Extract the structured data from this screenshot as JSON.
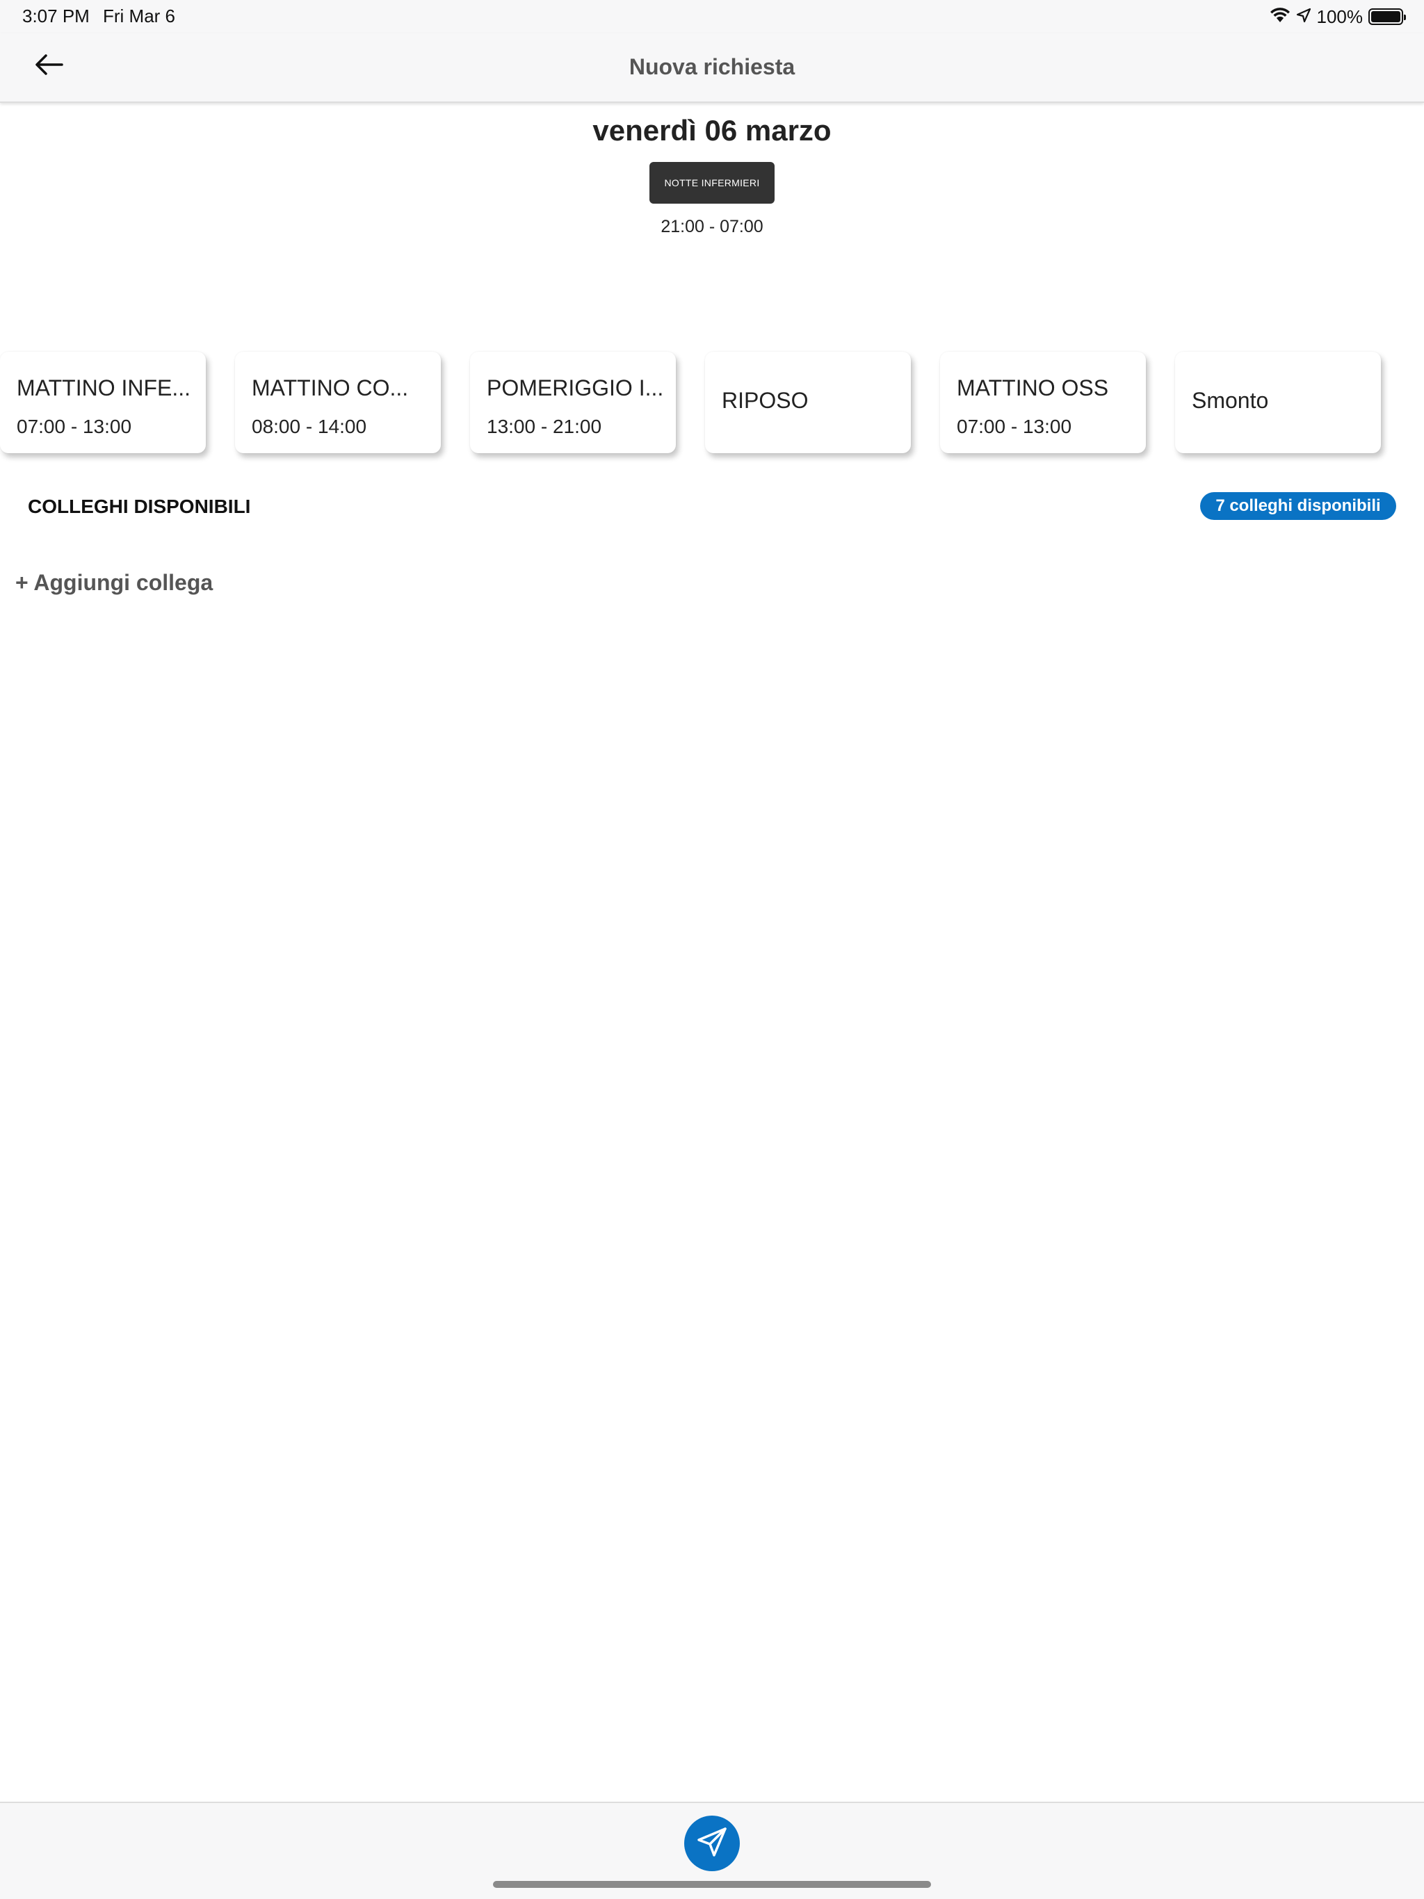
{
  "status_bar": {
    "time": "3:07 PM",
    "date": "Fri Mar 6",
    "battery": "100%",
    "icons": [
      "wifi-icon",
      "location-icon",
      "battery-icon"
    ]
  },
  "header": {
    "title": "Nuova richiesta",
    "back_icon": "arrow-left-icon"
  },
  "shift": {
    "date": "venerdì 06 marzo",
    "name": "NOTTE INFERMIERI",
    "time": "21:00 - 07:00"
  },
  "cards": [
    {
      "name": "MATTINO INFE...",
      "time": "07:00 - 13:00"
    },
    {
      "name": "MATTINO CO...",
      "time": "08:00 - 14:00"
    },
    {
      "name": "POMERIGGIO I...",
      "time": "13:00 - 21:00"
    },
    {
      "name": "RIPOSO",
      "time": ""
    },
    {
      "name": "MATTINO OSS",
      "time": "07:00 - 13:00"
    },
    {
      "name": "Smonto",
      "time": ""
    }
  ],
  "colleagues": {
    "title": "COLLEGHI DISPONIBILI",
    "badge": "7 colleghi disponibili",
    "add_label": "+ Aggiungi collega"
  },
  "bottom": {
    "send_icon": "send-icon"
  },
  "colors": {
    "accent": "#0a73c4",
    "chip": "#333333",
    "bar_bg": "#f7f7f8"
  }
}
